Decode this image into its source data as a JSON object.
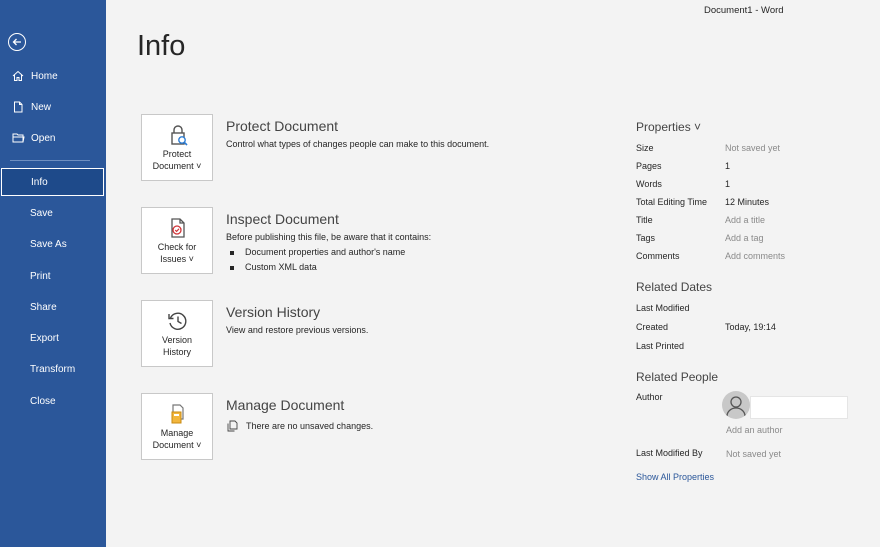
{
  "window": {
    "title": "Document1  -  Word"
  },
  "sidebar": {
    "items": [
      {
        "label": "Home"
      },
      {
        "label": "New"
      },
      {
        "label": "Open"
      },
      {
        "label": "Info"
      },
      {
        "label": "Save"
      },
      {
        "label": "Save As"
      },
      {
        "label": "Print"
      },
      {
        "label": "Share"
      },
      {
        "label": "Export"
      },
      {
        "label": "Transform"
      },
      {
        "label": "Close"
      }
    ]
  },
  "page": {
    "title": "Info"
  },
  "sections": {
    "protect": {
      "button_line1": "Protect",
      "button_line2": "Document ˅",
      "title": "Protect Document",
      "desc": "Control what types of changes people can make to this document."
    },
    "inspect": {
      "button_line1": "Check for",
      "button_line2": "Issues ˅",
      "title": "Inspect Document",
      "desc": "Before publishing this file, be aware that it contains:",
      "bullets": [
        "Document properties and author's name",
        "Custom XML data"
      ]
    },
    "version": {
      "button_line1": "Version",
      "button_line2": "History",
      "title": "Version History",
      "desc": "View and restore previous versions."
    },
    "manage": {
      "button_line1": "Manage",
      "button_line2": "Document ˅",
      "title": "Manage Document",
      "desc": "There are no unsaved changes."
    }
  },
  "properties": {
    "heading": "Properties ˅",
    "rows": [
      {
        "label": "Size",
        "value": "Not saved yet"
      },
      {
        "label": "Pages",
        "value": "1"
      },
      {
        "label": "Words",
        "value": "1"
      },
      {
        "label": "Total Editing Time",
        "value": "12 Minutes"
      },
      {
        "label": "Title",
        "value": "Add a title"
      },
      {
        "label": "Tags",
        "value": "Add a tag"
      },
      {
        "label": "Comments",
        "value": "Add comments"
      }
    ]
  },
  "related_dates": {
    "heading": "Related Dates",
    "rows": [
      {
        "label": "Last Modified",
        "value": ""
      },
      {
        "label": "Created",
        "value": "Today, 19:14"
      },
      {
        "label": "Last Printed",
        "value": ""
      }
    ]
  },
  "related_people": {
    "heading": "Related People",
    "author_label": "Author",
    "add_author": "Add an author",
    "last_modified_by_label": "Last Modified By",
    "last_modified_by_value": "Not saved yet",
    "show_all": "Show All Properties"
  },
  "colors": {
    "sidebar": "#2b579a",
    "accent": "#2b579a"
  }
}
